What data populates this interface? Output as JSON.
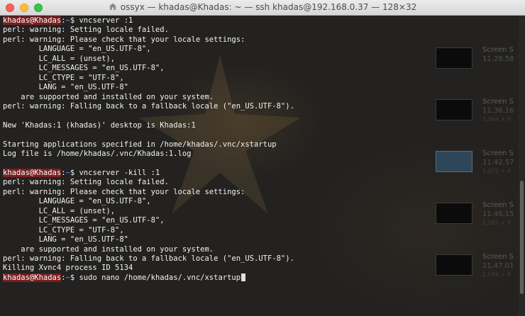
{
  "window": {
    "title": "ossyx — khadas@Khadas: ~ — ssh khadas@192.168.0.37 — 128×32"
  },
  "terminal": {
    "lines": [
      {
        "type": "prompt",
        "user": "khadas@Khadas",
        "sep": ":",
        "path": "~",
        "cmd": "$ vncserver :1"
      },
      {
        "type": "text",
        "text": "perl: warning: Setting locale failed."
      },
      {
        "type": "text",
        "text": "perl: warning: Please check that your locale settings:"
      },
      {
        "type": "text",
        "text": "        LANGUAGE = \"en_US.UTF-8\","
      },
      {
        "type": "text",
        "text": "        LC_ALL = (unset),"
      },
      {
        "type": "text",
        "text": "        LC_MESSAGES = \"en_US.UTF-8\","
      },
      {
        "type": "text",
        "text": "        LC_CTYPE = \"UTF-8\","
      },
      {
        "type": "text",
        "text": "        LANG = \"en_US.UTF-8\""
      },
      {
        "type": "text",
        "text": "    are supported and installed on your system."
      },
      {
        "type": "text",
        "text": "perl: warning: Falling back to a fallback locale (\"en_US.UTF-8\")."
      },
      {
        "type": "text",
        "text": ""
      },
      {
        "type": "text",
        "text": "New 'Khadas:1 (khadas)' desktop is Khadas:1"
      },
      {
        "type": "text",
        "text": ""
      },
      {
        "type": "text",
        "text": "Starting applications specified in /home/khadas/.vnc/xstartup"
      },
      {
        "type": "text",
        "text": "Log file is /home/khadas/.vnc/Khadas:1.log"
      },
      {
        "type": "text",
        "text": ""
      },
      {
        "type": "prompt",
        "user": "khadas@Khadas",
        "sep": ":",
        "path": "~",
        "cmd": "$ vncserver -kill :1"
      },
      {
        "type": "text",
        "text": "perl: warning: Setting locale failed."
      },
      {
        "type": "text",
        "text": "perl: warning: Please check that your locale settings:"
      },
      {
        "type": "text",
        "text": "        LANGUAGE = \"en_US.UTF-8\","
      },
      {
        "type": "text",
        "text": "        LC_ALL = (unset),"
      },
      {
        "type": "text",
        "text": "        LC_MESSAGES = \"en_US.UTF-8\","
      },
      {
        "type": "text",
        "text": "        LC_CTYPE = \"UTF-8\","
      },
      {
        "type": "text",
        "text": "        LANG = \"en_US.UTF-8\""
      },
      {
        "type": "text",
        "text": "    are supported and installed on your system."
      },
      {
        "type": "text",
        "text": "perl: warning: Falling back to a fallback locale (\"en_US.UTF-8\")."
      },
      {
        "type": "text",
        "text": "Killing Xvnc4 process ID 5134"
      },
      {
        "type": "prompt",
        "user": "khadas@Khadas",
        "sep": ":",
        "path": "~",
        "cmd": "$ sudo nano /home/khadas/.vnc/xstartup",
        "cursor": true
      }
    ]
  },
  "desktop": {
    "items": [
      {
        "name": "Screen S",
        "date": "11.28.58",
        "size": ""
      },
      {
        "name": "Screen S",
        "date": "11.36.16",
        "size": "1,584 × 9"
      },
      {
        "name": "Screen S",
        "date": "11.42.57",
        "size": "1,072 × 4"
      },
      {
        "name": "Screen S",
        "date": "11.46.15",
        "size": "1,582 × 9"
      },
      {
        "name": "Screen S",
        "date": "11.47.01",
        "size": "1,584 × 9"
      }
    ]
  },
  "colors": {
    "prompt_user_bg": "#7a1f1f",
    "prompt_path": "#5aa2ff",
    "terminal_bg": "#232220",
    "terminal_text": "#f2f2f2"
  }
}
